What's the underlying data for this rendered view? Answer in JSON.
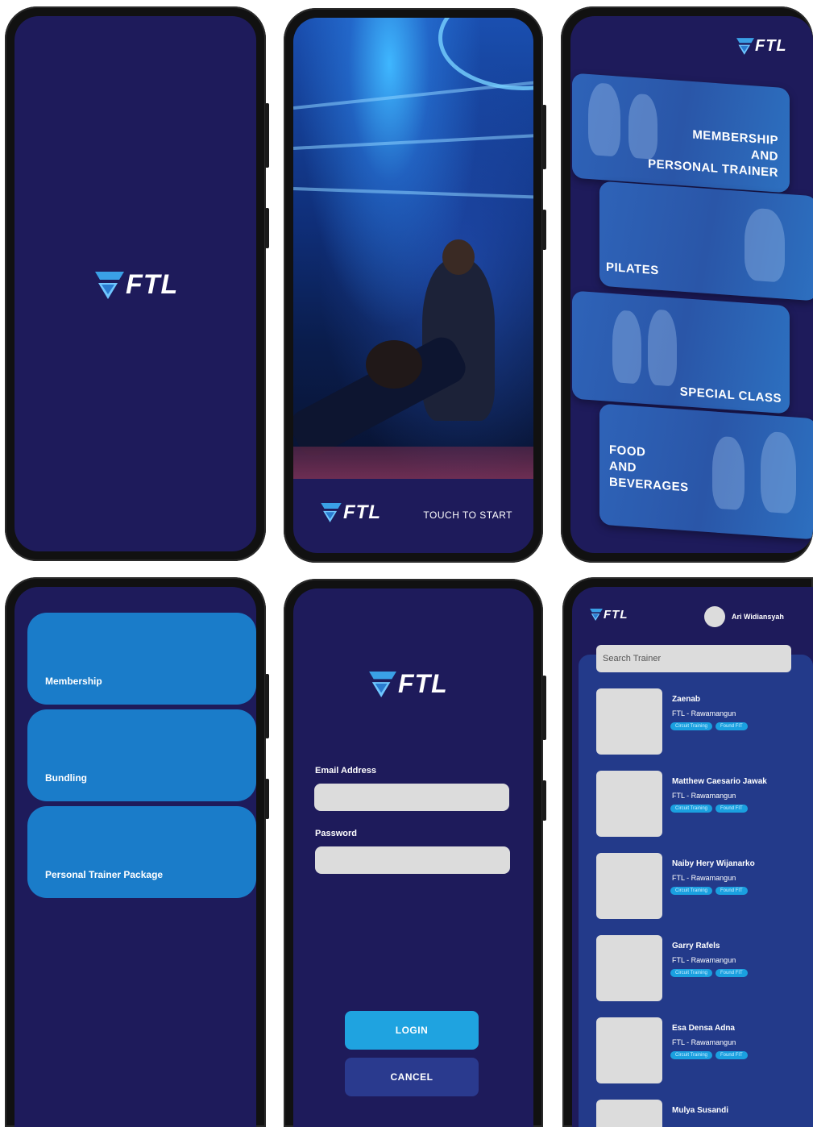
{
  "brand": {
    "logo_text": "FTL"
  },
  "colors": {
    "background": "#1e1b5b",
    "accent_blue": "#1a7cc9",
    "login_button": "#1fa3e0",
    "cancel_button": "#2a3a8e",
    "tag": "#1aa0e0"
  },
  "splash": {
    "logo": "FTL"
  },
  "welcome": {
    "touch_label": "TOUCH TO START"
  },
  "categories": [
    {
      "line1": "MEMBERSHIP",
      "line2": "AND",
      "line3": "PERSONAL TRAINER"
    },
    {
      "line1": "PILATES"
    },
    {
      "line1": "SPECIAL CLASS"
    },
    {
      "line1": "FOOD",
      "line2": "AND",
      "line3": "BEVERAGES"
    }
  ],
  "menu": {
    "items": [
      {
        "label": "Membership"
      },
      {
        "label": "Bundling"
      },
      {
        "label": "Personal Trainer Package"
      }
    ]
  },
  "login": {
    "email_label": "Email Address",
    "email_value": "",
    "password_label": "Password",
    "password_value": "",
    "login_label": "LOGIN",
    "cancel_label": "CANCEL"
  },
  "trainers": {
    "user_name": "Ari Widiansyah",
    "search_placeholder": "Search Trainer",
    "list": [
      {
        "name": "Zaenab",
        "location": "FTL - Rawamangun",
        "tags": [
          "Circuit Training",
          "Found FIT"
        ]
      },
      {
        "name": "Matthew Caesario Jawak",
        "location": "FTL - Rawamangun",
        "tags": [
          "Circuit Training",
          "Found FIT"
        ]
      },
      {
        "name": "Naiby Hery Wijanarko",
        "location": "FTL - Rawamangun",
        "tags": [
          "Circuit Training",
          "Found FIT"
        ]
      },
      {
        "name": "Garry Rafels",
        "location": "FTL - Rawamangun",
        "tags": [
          "Circuit Training",
          "Found FIT"
        ]
      },
      {
        "name": "Esa Densa Adna",
        "location": "FTL - Rawamangun",
        "tags": [
          "Circuit Training",
          "Found FIT"
        ]
      },
      {
        "name": "Mulya Susandi",
        "location": "",
        "tags": []
      }
    ]
  }
}
